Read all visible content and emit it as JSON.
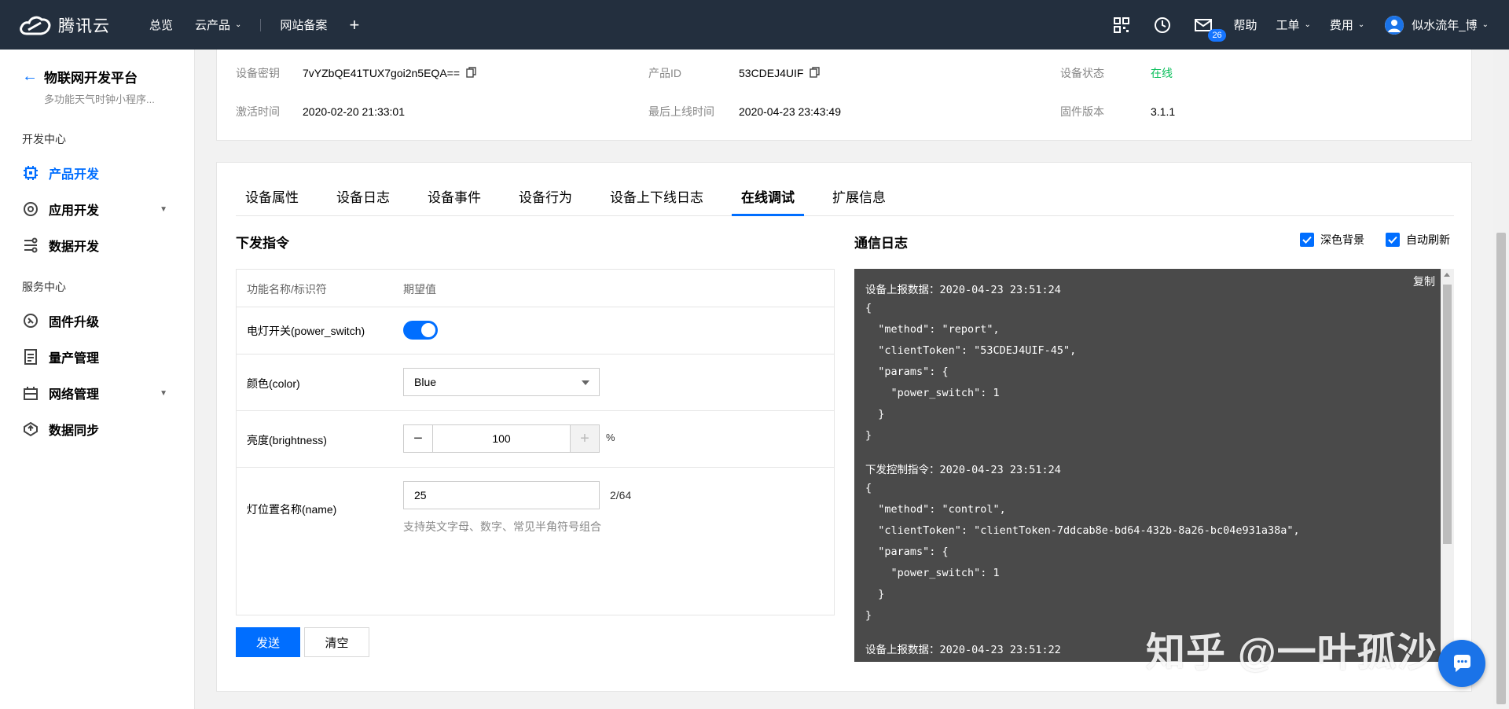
{
  "topbar": {
    "brand": "腾讯云",
    "nav": [
      "总览",
      "云产品",
      "网站备案"
    ],
    "mail_count": "26",
    "help": "帮助",
    "ticket": "工单",
    "billing": "费用",
    "username": "似水流年_博"
  },
  "sidebar": {
    "title": "物联网开发平台",
    "subtitle": "多功能天气时钟小程序...",
    "group_dev": "开发中心",
    "group_service": "服务中心",
    "items": [
      {
        "label": "产品开发"
      },
      {
        "label": "应用开发"
      },
      {
        "label": "数据开发"
      },
      {
        "label": "固件升级"
      },
      {
        "label": "量产管理"
      },
      {
        "label": "网络管理"
      },
      {
        "label": "数据同步"
      }
    ]
  },
  "device_info": {
    "secret_label": "设备密钥",
    "secret_value": "7vYZbQE41TUX7goi2n5EQA==",
    "product_id_label": "产品ID",
    "product_id_value": "53CDEJ4UIF",
    "status_label": "设备状态",
    "status_value": "在线",
    "activated_label": "激活时间",
    "activated_value": "2020-02-20 21:33:01",
    "last_online_label": "最后上线时间",
    "last_online_value": "2020-04-23 23:43:49",
    "firmware_label": "固件版本",
    "firmware_value": "3.1.1"
  },
  "tabs": [
    "设备属性",
    "设备日志",
    "设备事件",
    "设备行为",
    "设备上下线日志",
    "在线调试",
    "扩展信息"
  ],
  "active_tab": "在线调试",
  "command": {
    "title": "下发指令",
    "col_name": "功能名称/标识符",
    "col_value": "期望值",
    "switch_label": "电灯开关(power_switch)",
    "switch_on": true,
    "color_label": "颜色(color)",
    "color_value": "Blue",
    "brightness_label": "亮度(brightness)",
    "brightness_value": "100",
    "brightness_unit": "%",
    "name_label": "灯位置名称(name)",
    "name_value": "25",
    "name_counter": "2/64",
    "name_hint": "支持英文字母、数字、常见半角符号组合",
    "send": "发送",
    "clear": "清空"
  },
  "log": {
    "title": "通信日志",
    "dark_bg": "深色背景",
    "auto_refresh": "自动刷新",
    "copy": "复制",
    "lines": [
      "设备上报数据：2020-04-23 23:51:24",
      "{",
      "  \"method\": \"report\",",
      "  \"clientToken\": \"53CDEJ4UIF-45\",",
      "  \"params\": {",
      "    \"power_switch\": 1",
      "  }",
      "}",
      "下发控制指令：2020-04-23 23:51:24",
      "{",
      "  \"method\": \"control\",",
      "  \"clientToken\": \"clientToken-7ddcab8e-bd64-432b-8a26-bc04e931a38a\",",
      "  \"params\": {",
      "    \"power_switch\": 1",
      "  }",
      "}",
      "设备上报数据：2020-04-23 23:51:22"
    ]
  },
  "watermark": "知乎 @一叶孤沙"
}
